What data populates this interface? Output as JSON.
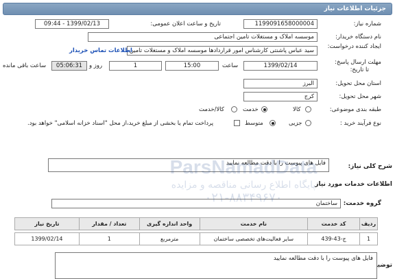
{
  "header": {
    "title": "جزئیات اطلاعات نیاز"
  },
  "fields": {
    "need_number_label": "شماره نیاز:",
    "need_number": "1199091658000004",
    "announce_label": "تاریخ و ساعت اعلان عمومی:",
    "announce_value": "1399/02/13 - 09:44",
    "buyer_org_label": "نام دستگاه خریدار:",
    "buyer_org": "موسسه املاک و مستغلات تامین اجتماعی",
    "creator_label": "ایجاد کننده درخواست:",
    "creator": "سید عباس پاشنتی کارشناس امور قراردادها موسسه املاک و مستغلات تامین",
    "contact_link": "اطلاعات تماس خریدار",
    "deadline_label": "مهلت ارسال پاسخ:",
    "deadline_label2": "تا تاریخ:",
    "deadline_date": "1399/02/14",
    "time_label": "ساعت",
    "deadline_time": "15:00",
    "days_value": "1",
    "days_label": "روز و",
    "remaining_time": "05:06:31",
    "remaining_label": "ساعت باقی مانده",
    "province_label": "استان محل تحویل:",
    "province": "البرز",
    "city_label": "شهر محل تحویل:",
    "city": "کرج",
    "category_label": "طبقه بندی موضوعی:",
    "category_options": [
      "کالا",
      "خدمت",
      "کالا/خدمت"
    ],
    "category_selected": "خدمت",
    "purchase_type_label": "نوع فرآیند خرید :",
    "purchase_options": [
      "جزیی",
      "متوسط"
    ],
    "purchase_selected": "متوسط",
    "payment_note": "پرداخت تمام یا بخشی از مبلغ خرید،از محل \"اسناد خزانه اسلامی\" خواهد بود."
  },
  "summary": {
    "label": "شرح کلی نیاز:",
    "value": "فایل های پیوست را با دقت مطالعه نمایید"
  },
  "services": {
    "section_title": "اطلاعات خدمات مورد نیاز",
    "group_label": "گروه خدمت:",
    "group_value": "ساختمان",
    "columns": [
      "ردیف",
      "کد خدمت",
      "نام خدمت",
      "واحد اندازه گیری",
      "تعداد / مقدار",
      "تاریخ نیاز"
    ],
    "rows": [
      [
        "1",
        "ج-43-439",
        "سایر فعالیت‌های تخصصی ساختمان",
        "مترمربع",
        "1",
        "1399/02/14"
      ]
    ]
  },
  "buyer_notes": {
    "label": "توضیحات خریدار:",
    "value": "فایل های پیوست را با دقت مطالعه نمایید"
  },
  "watermark": {
    "line1": "ParsNamadData",
    "line2": "پایگاه اطلاع رسانی مناقصه و مزایده",
    "line3": "۰۲۱-۸۸۳۴۹۶۷۰"
  },
  "colors": {
    "header": "#7895b8",
    "link": "#1a4fb5",
    "table_head": "#e9e9e9"
  }
}
